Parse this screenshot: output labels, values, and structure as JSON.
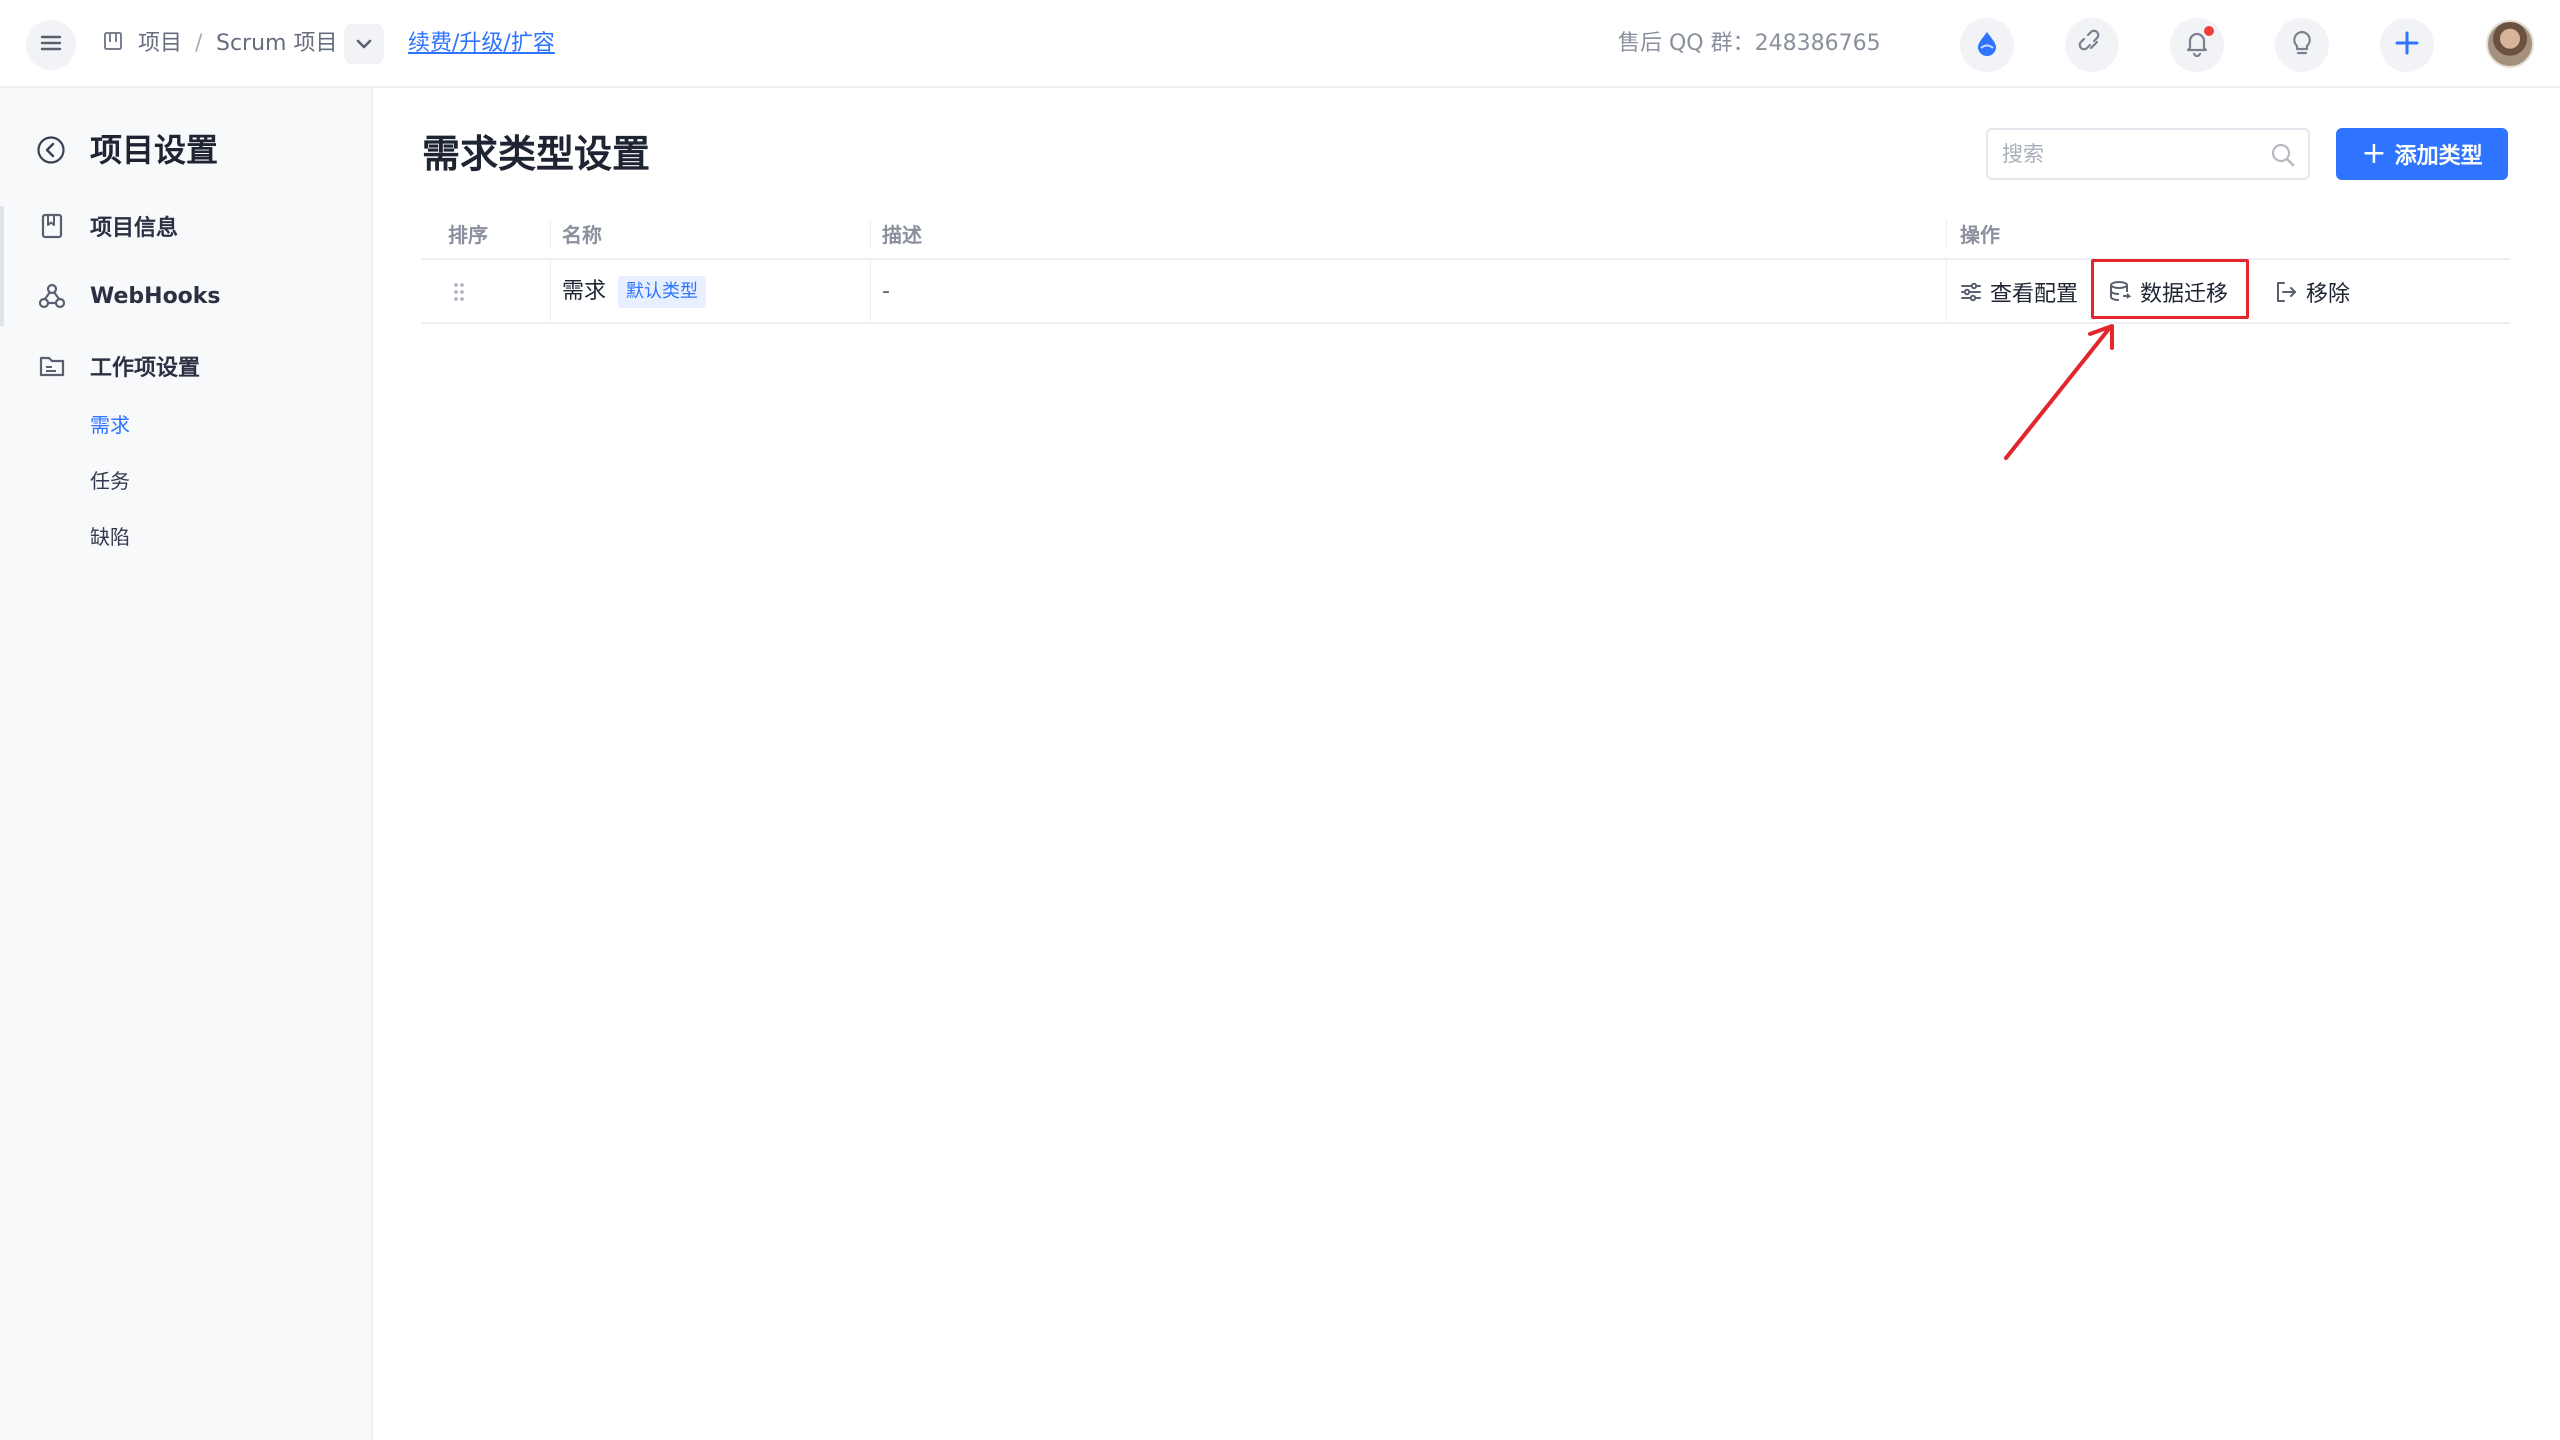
{
  "topbar": {
    "breadcrumb": {
      "project": "项目",
      "separator": "/",
      "current": "Scrum 项目"
    },
    "upgrade_link": "续费/升级/扩容",
    "support_text": "售后 QQ 群：248386765",
    "icons": [
      "drop-icon",
      "link-icon",
      "bell-icon",
      "bulb-icon",
      "plus-icon"
    ]
  },
  "sidebar": {
    "title": "项目设置",
    "items": [
      {
        "label": "项目信息",
        "icon": "bookmark-icon"
      },
      {
        "label": "WebHooks",
        "icon": "webhook-icon"
      },
      {
        "label": "工作项设置",
        "icon": "folder-icon"
      }
    ],
    "sub_items": [
      {
        "label": "需求",
        "active": true
      },
      {
        "label": "任务",
        "active": false
      },
      {
        "label": "缺陷",
        "active": false
      }
    ]
  },
  "main": {
    "title": "需求类型设置",
    "search_placeholder": "搜索",
    "add_button": "添加类型",
    "columns": [
      "排序",
      "名称",
      "描述",
      "操作"
    ],
    "rows": [
      {
        "name": "需求",
        "tag": "默认类型",
        "description": "-",
        "actions": {
          "view": "查看配置",
          "migrate": "数据迁移",
          "remove": "移除"
        }
      }
    ]
  },
  "colors": {
    "primary": "#2e74ff",
    "highlight": "#e3262b"
  }
}
